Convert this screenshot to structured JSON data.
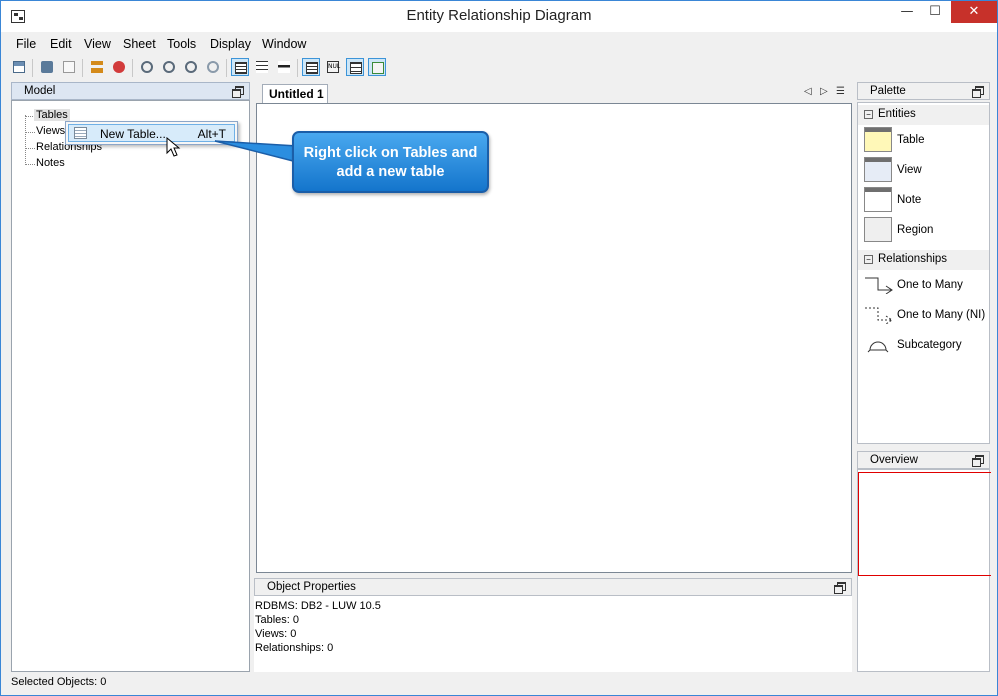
{
  "window": {
    "title": "Entity Relationship Diagram",
    "minimize": "—",
    "maximize": "☐",
    "close": "✕"
  },
  "menu": [
    "File",
    "Edit",
    "View",
    "Sheet",
    "Tools",
    "Display",
    "Window"
  ],
  "model_panel": {
    "title": "Model",
    "tree": [
      "Tables",
      "Views",
      "Relationships",
      "Notes"
    ]
  },
  "context_menu": {
    "label": "New Table...",
    "accelerator": "Alt+T"
  },
  "editor": {
    "tab": "Untitled 1"
  },
  "callout": {
    "line1": "Right click on Tables and",
    "line2": "add a new table"
  },
  "properties": {
    "title": "Object Properties",
    "lines": [
      "RDBMS: DB2 - LUW 10.5",
      "Tables: 0",
      "Views: 0",
      "Relationships: 0"
    ]
  },
  "palette": {
    "title": "Palette",
    "entities_header": "Entities",
    "entities": [
      "Table",
      "View",
      "Note",
      "Region"
    ],
    "relationships_header": "Relationships",
    "relationships": [
      "One to Many",
      "One to Many (NI)",
      "Subcategory"
    ]
  },
  "overview": {
    "title": "Overview"
  },
  "status": "Selected Objects: 0"
}
